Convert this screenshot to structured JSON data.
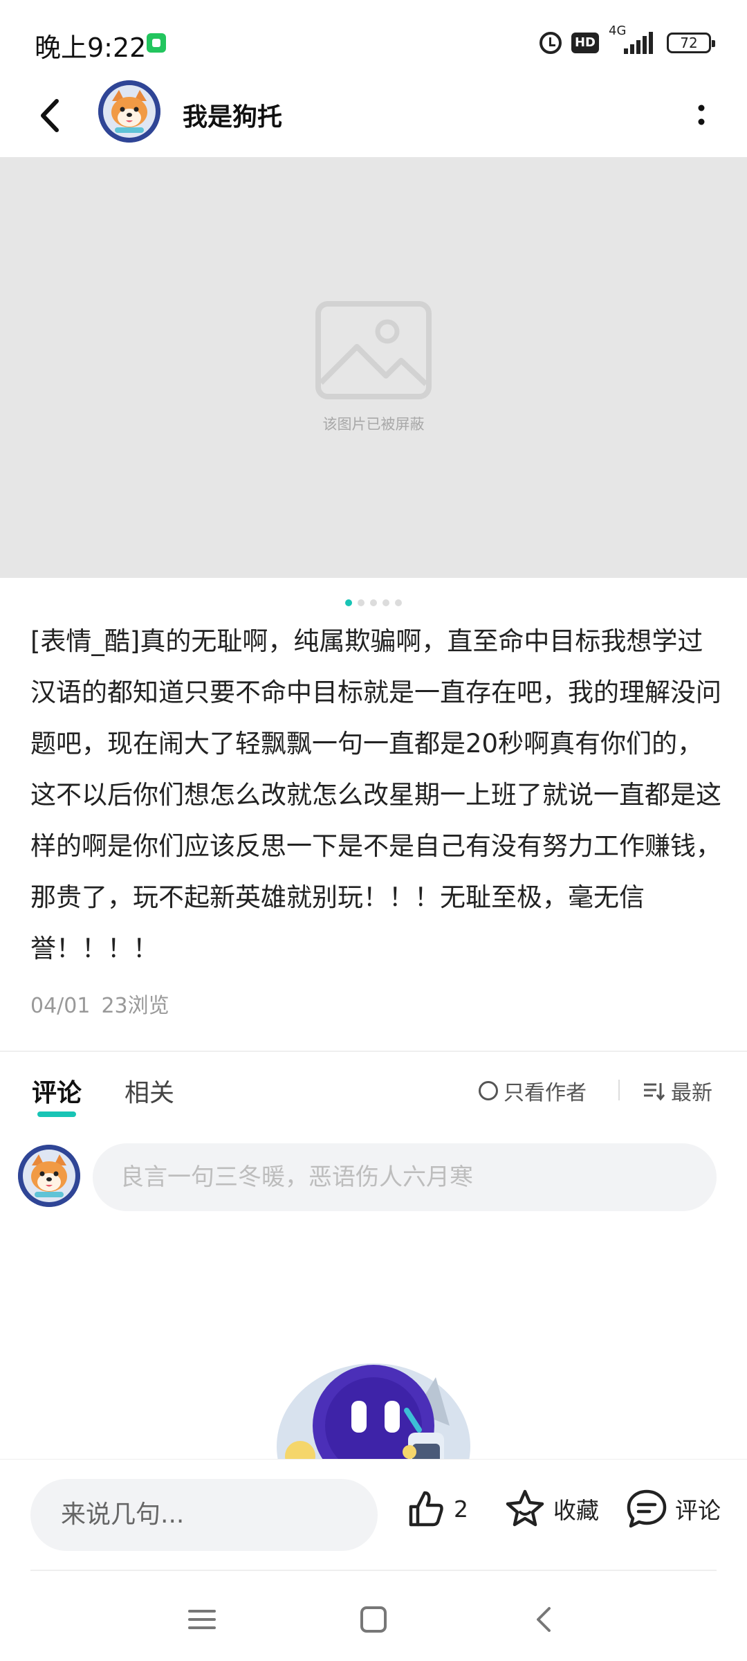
{
  "status_bar": {
    "time": "晚上9:22",
    "hd": "HD",
    "network": "4G",
    "battery": "72"
  },
  "header": {
    "author_name": "我是狗托"
  },
  "image": {
    "blocked_text": "该图片已被屏蔽",
    "page_count": 5,
    "current_page": 1
  },
  "post": {
    "text": "[表情_酷]真的无耻啊，纯属欺骗啊，直至命中目标我想学过汉语的都知道只要不命中目标就是一直存在吧，我的理解没问题吧，现在闹大了轻飘飘一句一直都是20秒啊真有你们的，这不以后你们想怎么改就怎么改星期一上班了就说一直都是这样的啊是你们应该反思一下是不是自己有没有努力工作赚钱，那贵了，玩不起新英雄就别玩！！！无耻至极，毫无信誉！！！！",
    "date": "04/01",
    "views": "23浏览"
  },
  "tabs": {
    "comments": "评论",
    "related": "相关",
    "only_author": "只看作者",
    "sort_latest": "最新"
  },
  "comment_input": {
    "placeholder": "良言一句三冬暖，恶语伤人六月寒"
  },
  "bottom_bar": {
    "say_placeholder": "来说几句...",
    "like_count": "2",
    "favorite_label": "收藏",
    "comment_label": "评论"
  },
  "colors": {
    "accent": "#18c4b5",
    "placeholder_bg": "#e6e6e6"
  },
  "icons": [
    "back-icon",
    "more-icon",
    "image-placeholder-icon",
    "like-icon",
    "star-icon",
    "comment-icon",
    "menu-icon",
    "home-icon",
    "nav-back-icon"
  ]
}
